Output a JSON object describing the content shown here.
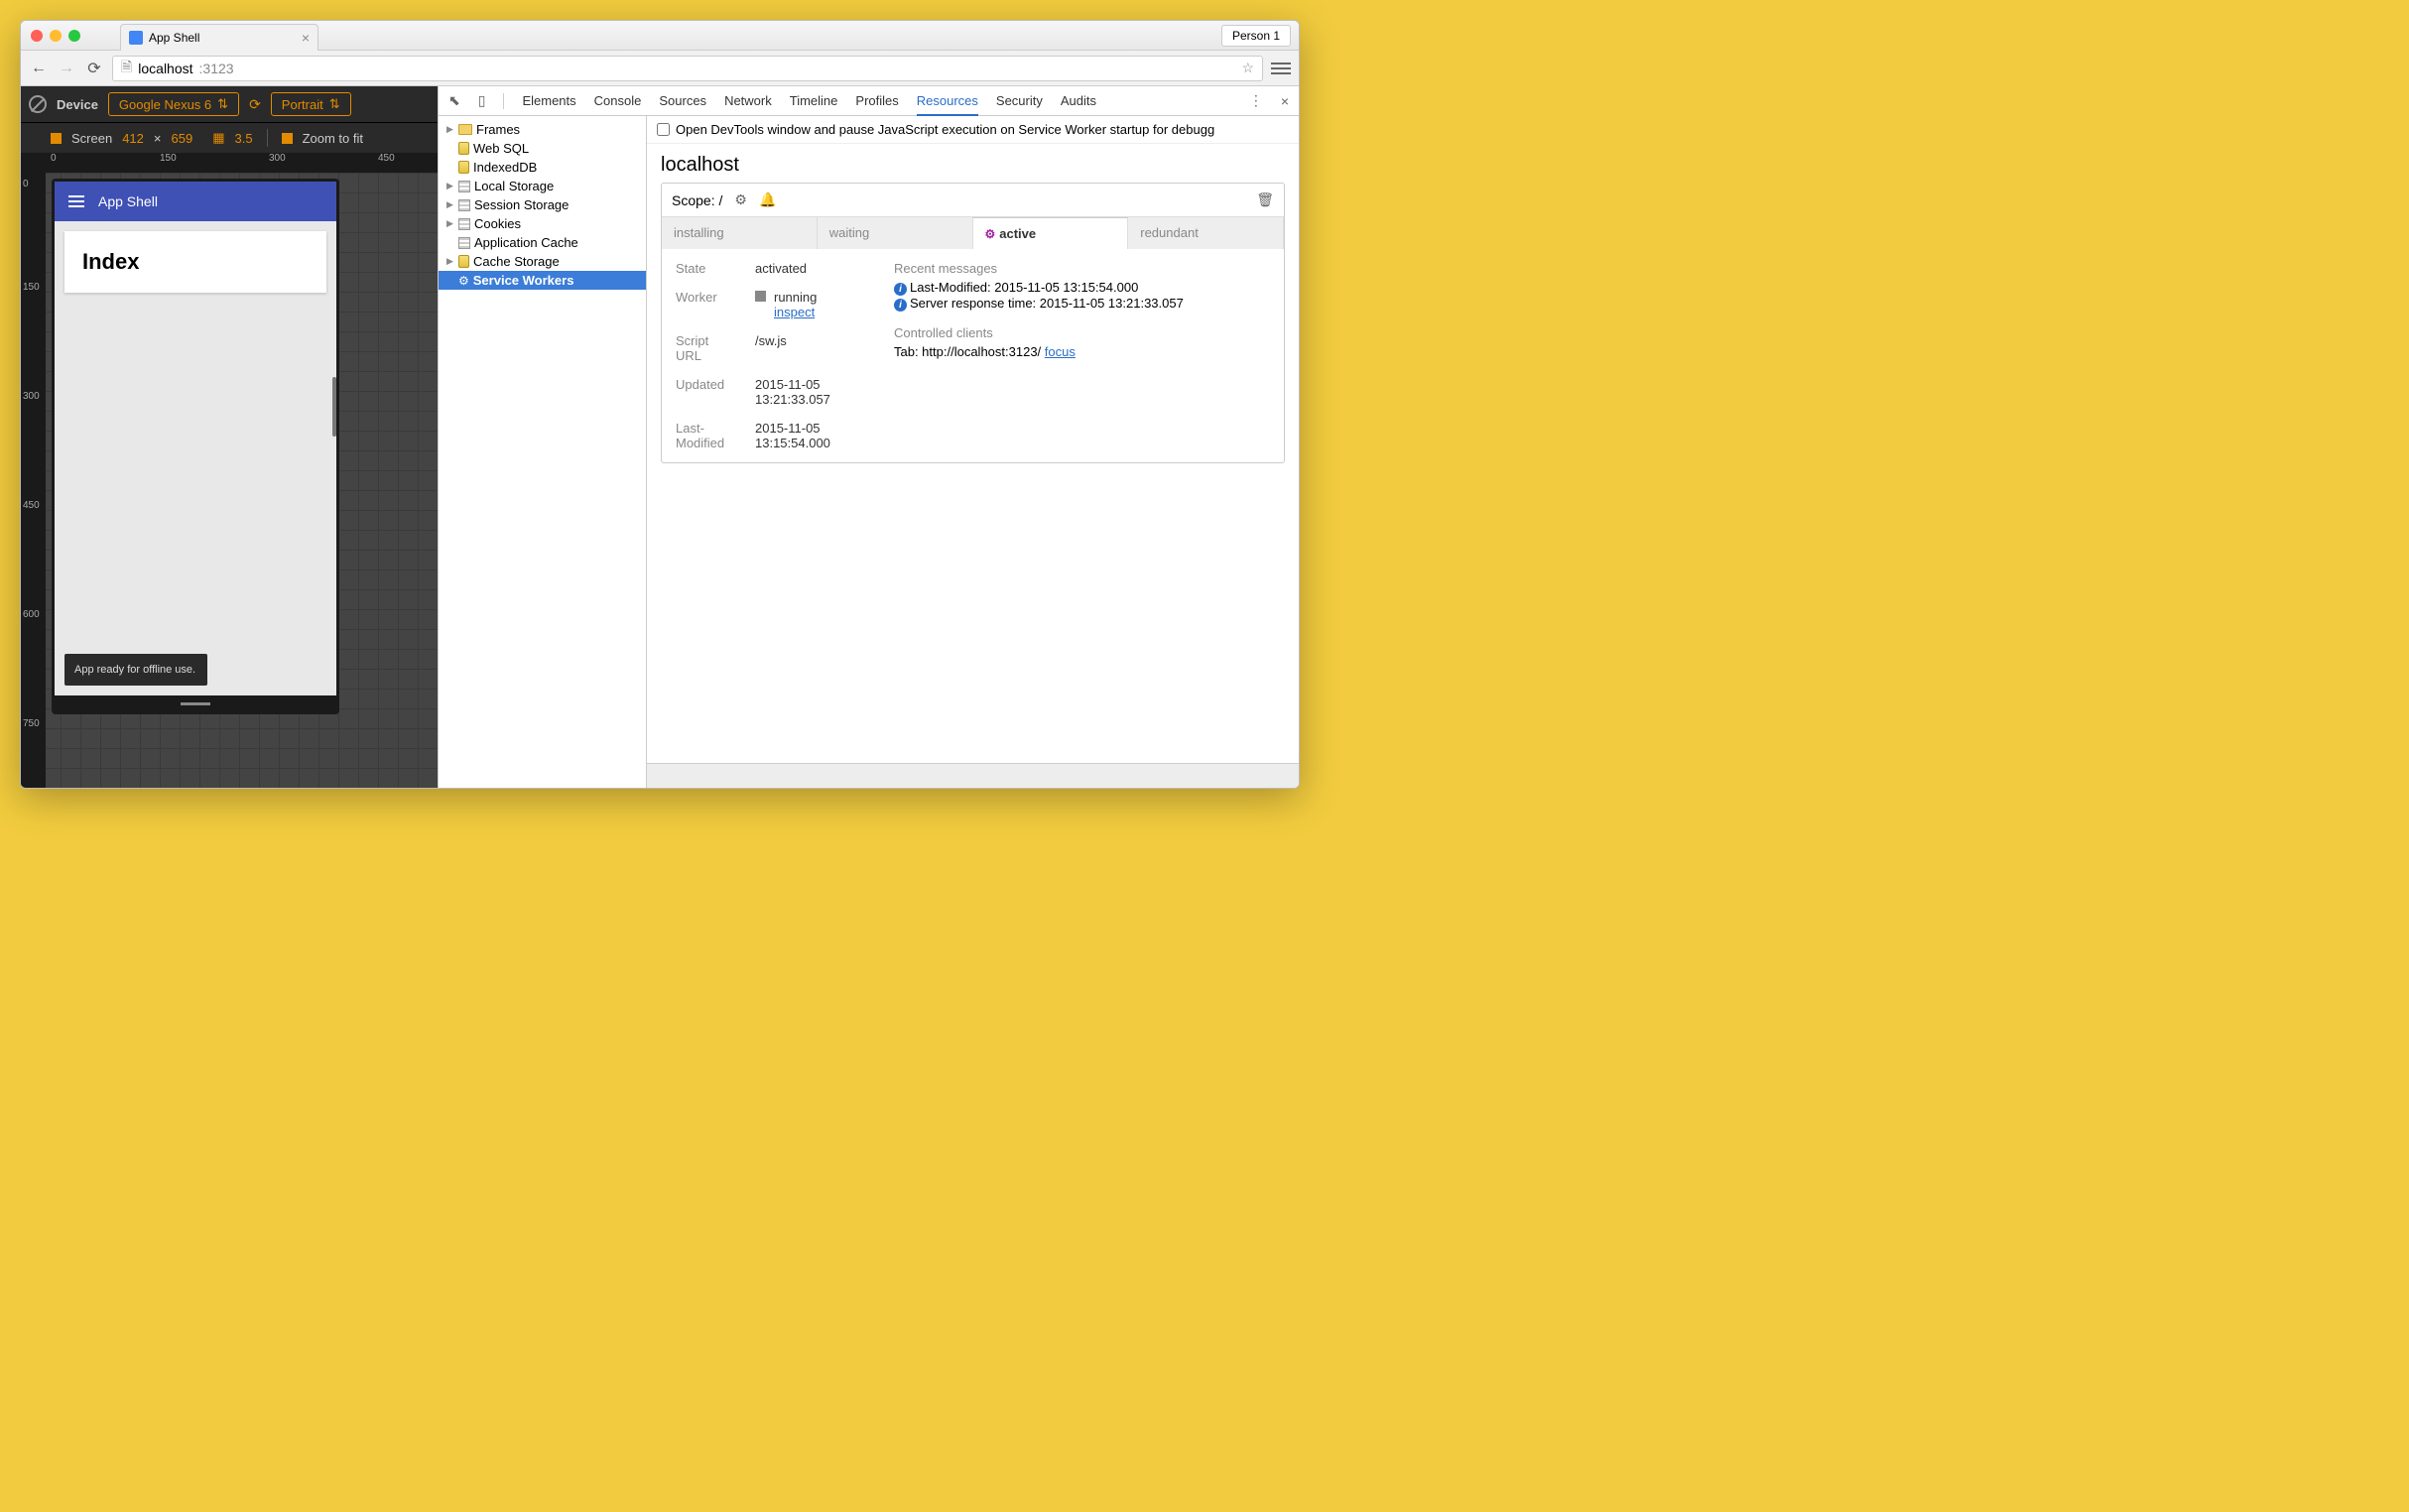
{
  "browser": {
    "tab_title": "App Shell",
    "person": "Person 1",
    "address": "localhost:3123",
    "address_port": ":3123"
  },
  "device_toolbar": {
    "device_label": "Device",
    "device_name": "Google Nexus 6",
    "orientation": "Portrait",
    "screen_label": "Screen",
    "width": "412",
    "height": "659",
    "dpr": "3.5",
    "zoom_label": "Zoom to fit"
  },
  "ruler": {
    "h": [
      "0",
      "150",
      "300",
      "450"
    ],
    "v": [
      "0",
      "150",
      "300",
      "450",
      "600",
      "750"
    ]
  },
  "app": {
    "title": "App Shell",
    "card_heading": "Index",
    "toast": "App ready for offline use."
  },
  "devtools": {
    "tabs": [
      "Elements",
      "Console",
      "Sources",
      "Network",
      "Timeline",
      "Profiles",
      "Resources",
      "Security",
      "Audits"
    ],
    "active_tab": "Resources",
    "banner": "Open DevTools window and pause JavaScript execution on Service Worker startup for debugg",
    "tree": {
      "frames": "Frames",
      "websql": "Web SQL",
      "indexeddb": "IndexedDB",
      "localstorage": "Local Storage",
      "sessionstorage": "Session Storage",
      "cookies": "Cookies",
      "appcache": "Application Cache",
      "cachestorage": "Cache Storage",
      "sw": "Service Workers"
    },
    "sw": {
      "host": "localhost",
      "scope_label": "Scope: /",
      "tabs": {
        "installing": "installing",
        "waiting": "waiting",
        "active": "active",
        "redundant": "redundant"
      },
      "state_label": "State",
      "state": "activated",
      "worker_label": "Worker",
      "worker_status": "running",
      "worker_action": "inspect",
      "script_label": "Script URL",
      "script": "/sw.js",
      "updated_label": "Updated",
      "updated": "2015-11-05 13:21:33.057",
      "lastmod_label": "Last-Modified",
      "lastmod": "2015-11-05 13:15:54.000",
      "recent_label": "Recent messages",
      "msg1": "Last-Modified: 2015-11-05 13:15:54.000",
      "msg2": "Server response time: 2015-11-05 13:21:33.057",
      "clients_label": "Controlled clients",
      "client_prefix": "Tab: http://localhost:3123/ ",
      "client_action": "focus"
    }
  }
}
